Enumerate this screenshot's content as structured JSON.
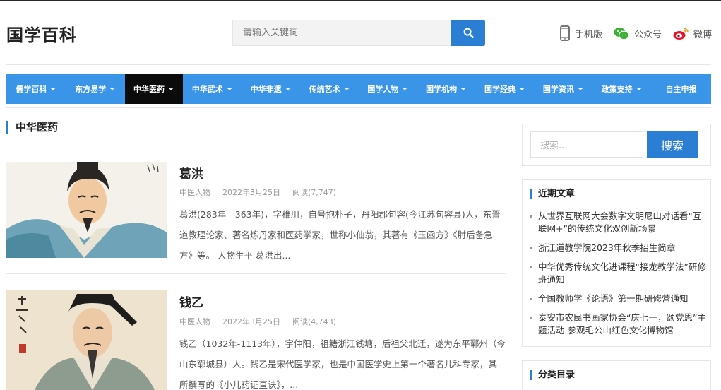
{
  "site": {
    "logo": "国学百科"
  },
  "search": {
    "placeholder": "请输入关键词"
  },
  "header_links": [
    {
      "label": "手机版",
      "icon": "mobile-icon"
    },
    {
      "label": "公众号",
      "icon": "wechat-icon"
    },
    {
      "label": "微博",
      "icon": "weibo-icon"
    }
  ],
  "nav": [
    {
      "label": "儒学百科",
      "dropdown": true
    },
    {
      "label": "东方易学",
      "dropdown": true
    },
    {
      "label": "中华医药",
      "dropdown": true,
      "active": true
    },
    {
      "label": "中华武术",
      "dropdown": true
    },
    {
      "label": "中华非遗",
      "dropdown": true
    },
    {
      "label": "传统艺术",
      "dropdown": true
    },
    {
      "label": "国学人物",
      "dropdown": true
    },
    {
      "label": "国学机构",
      "dropdown": true
    },
    {
      "label": "国学经典",
      "dropdown": true
    },
    {
      "label": "国学资讯",
      "dropdown": true
    },
    {
      "label": "政策支持",
      "dropdown": true
    },
    {
      "label": "自主申报",
      "dropdown": false
    }
  ],
  "section": {
    "title": "中华医药"
  },
  "posts": [
    {
      "title": "葛洪",
      "category": "中医人物",
      "date": "2022年3月25日",
      "views": "阅读(7,747)",
      "excerpt": "葛洪(283年—363年)，字稚川，自号抱朴子，丹阳郡句容(今江苏句容县)人，东晋道教理论家、著名炼丹家和医药学家，世称小仙翁，其著有《玉函方》《肘后备急方》等。 人物生平 葛洪出..."
    },
    {
      "title": "钱乙",
      "category": "中医人物",
      "date": "2022年3月25日",
      "views": "阅读(4,743)",
      "excerpt": "钱乙（1032年-1113年），字仲阳，祖籍浙江钱塘，后祖父北迁，遂为东平郓州（今山东郓城县）人。钱乙是宋代医学家，也是中国医学史上第一个著名儿科专家，其所撰写的《小儿药证直诀》，..."
    }
  ],
  "sidebar": {
    "search_placeholder": "搜索...",
    "search_button": "搜索",
    "recent_title": "近期文章",
    "recent": [
      "从世界互联网大会数字文明尼山对话看“互联网+”的传统文化双创新场景",
      "浙江道教学院2023年秋季招生简章",
      "中华优秀传统文化进课程“接龙教学法”研修班通知",
      "全国教师学《论语》第一期研修营通知",
      "泰安市农民书画家协会“庆七一，颂党恩”主题活动 参观毛公山红色文化博物馆"
    ],
    "category_title": "分类目录"
  },
  "colors": {
    "accent": "#2a7ed4",
    "nav_bg": "#3a95e8",
    "nav_active": "#0b0b0b"
  }
}
